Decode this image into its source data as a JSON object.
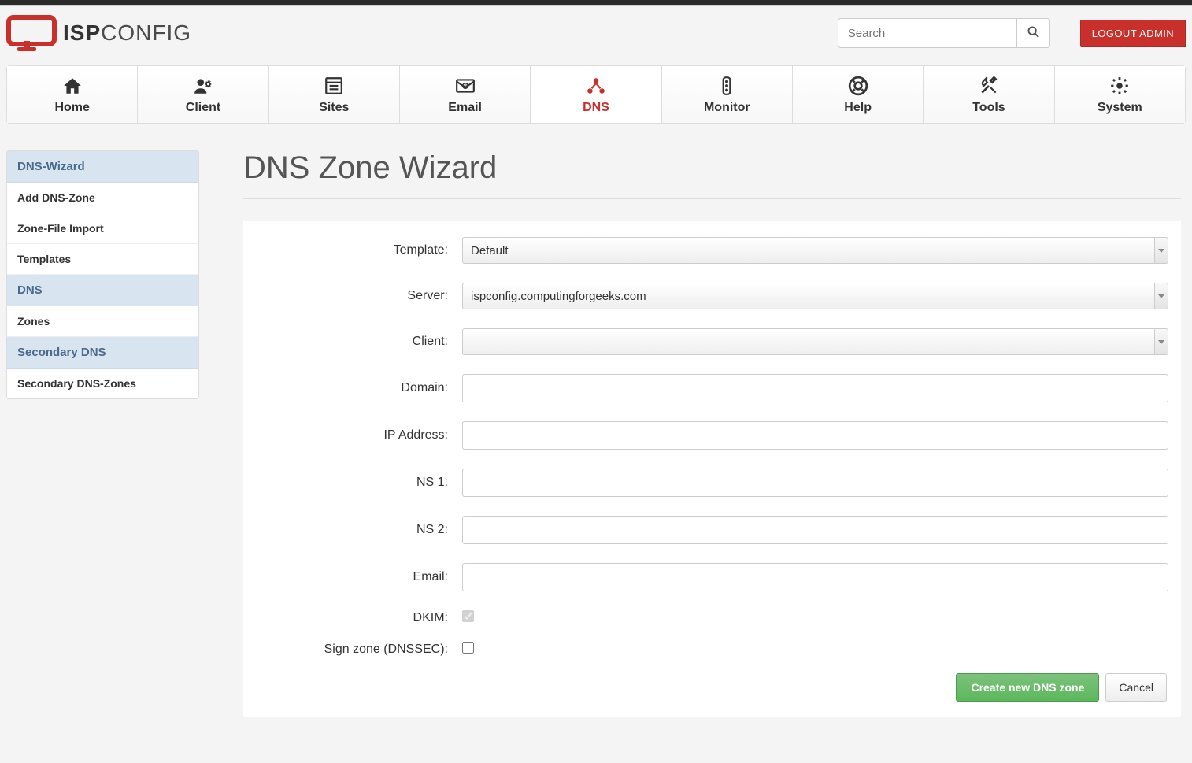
{
  "brand": {
    "strong": "ISP",
    "light": "CONFIG"
  },
  "search": {
    "placeholder": "Search"
  },
  "logout": {
    "label": "LOGOUT ADMIN"
  },
  "nav": {
    "items": [
      {
        "label": "Home"
      },
      {
        "label": "Client"
      },
      {
        "label": "Sites"
      },
      {
        "label": "Email"
      },
      {
        "label": "DNS",
        "active": true
      },
      {
        "label": "Monitor"
      },
      {
        "label": "Help"
      },
      {
        "label": "Tools"
      },
      {
        "label": "System"
      }
    ]
  },
  "sidebar": {
    "groups": [
      {
        "header": "DNS-Wizard",
        "items": [
          "Add DNS-Zone",
          "Zone-File Import",
          "Templates"
        ]
      },
      {
        "header": "DNS",
        "items": [
          "Zones"
        ]
      },
      {
        "header": "Secondary DNS",
        "items": [
          "Secondary DNS-Zones"
        ]
      }
    ]
  },
  "page": {
    "title": "DNS Zone Wizard"
  },
  "form": {
    "template_label": "Template:",
    "template_value": "Default",
    "server_label": "Server:",
    "server_value": "ispconfig.computingforgeeks.com",
    "client_label": "Client:",
    "client_value": "",
    "domain_label": "Domain:",
    "domain_value": "",
    "ip_label": "IP Address:",
    "ip_value": "",
    "ns1_label": "NS 1:",
    "ns1_value": "",
    "ns2_label": "NS 2:",
    "ns2_value": "",
    "email_label": "Email:",
    "email_value": "",
    "dkim_label": "DKIM:",
    "dnssec_label": "Sign zone (DNSSEC):",
    "submit_label": "Create new DNS zone",
    "cancel_label": "Cancel"
  }
}
